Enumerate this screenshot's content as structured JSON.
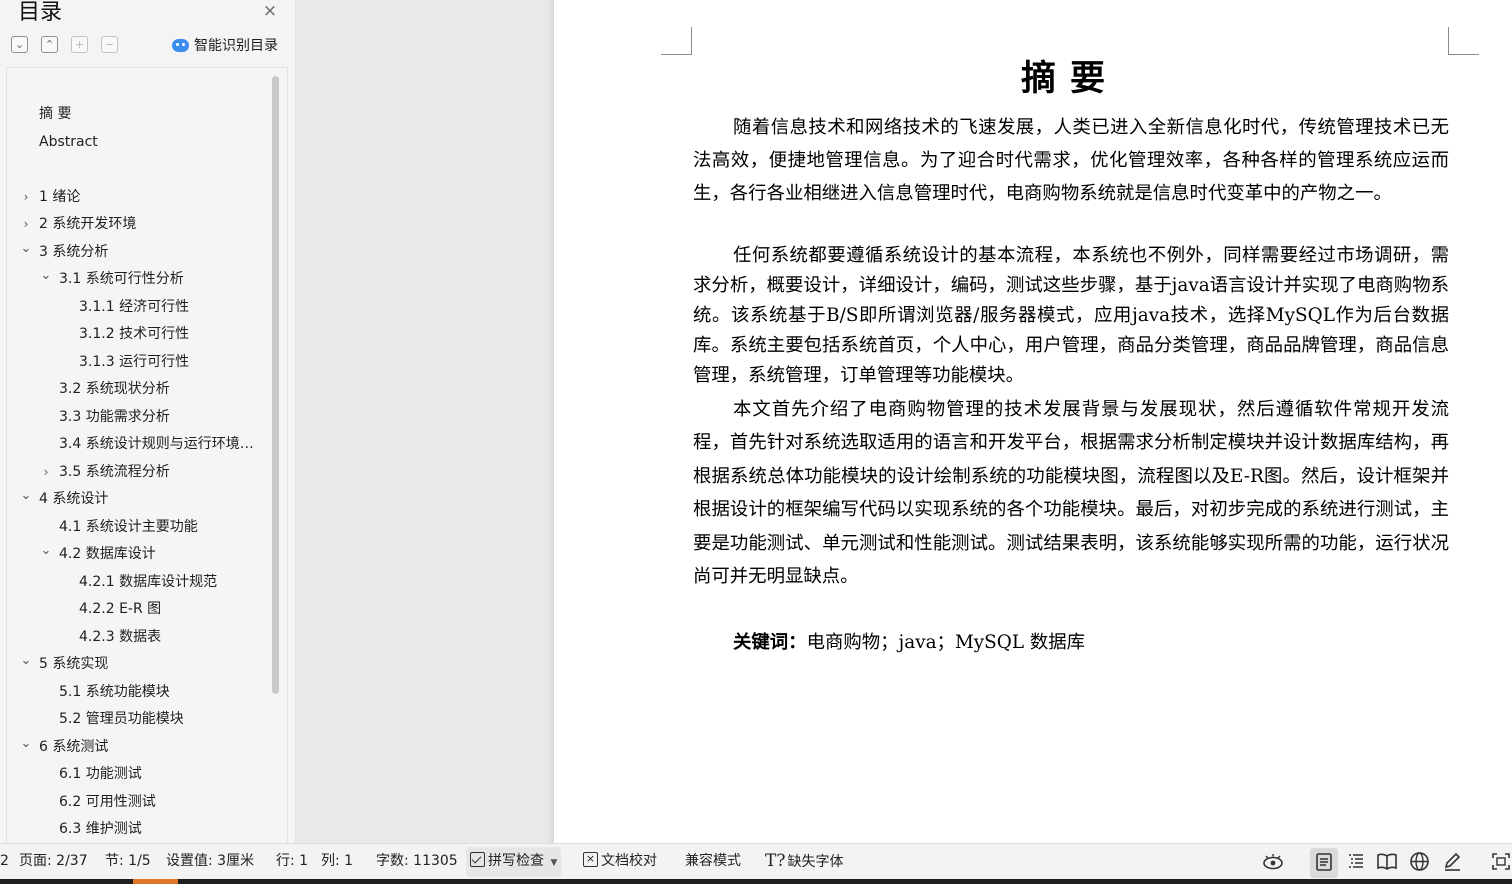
{
  "sidebar": {
    "title": "目录",
    "close_icon": "×",
    "tools": [
      {
        "name": "collapse-all",
        "glyph": "⌄"
      },
      {
        "name": "expand-all",
        "glyph": "⌃"
      },
      {
        "name": "add-level",
        "glyph": "+"
      },
      {
        "name": "remove-level",
        "glyph": "−"
      }
    ],
    "smart_toc_label": "智能识别目录",
    "toc": [
      {
        "label": "摘  要",
        "level": 0,
        "arrow": ""
      },
      {
        "label": "Abstract",
        "level": 0,
        "arrow": ""
      },
      {
        "label": "1  绪论",
        "level": 0,
        "arrow": "›"
      },
      {
        "label": "2  系统开发环境",
        "level": 0,
        "arrow": "›"
      },
      {
        "label": "3  系统分析",
        "level": 0,
        "arrow": "⌄"
      },
      {
        "label": "3.1 系统可行性分析",
        "level": 1,
        "arrow": "⌄"
      },
      {
        "label": "3.1.1 经济可行性",
        "level": 2,
        "arrow": ""
      },
      {
        "label": "3.1.2 技术可行性",
        "level": 2,
        "arrow": ""
      },
      {
        "label": "3.1.3 运行可行性",
        "level": 2,
        "arrow": ""
      },
      {
        "label": "3.2  系统现状分析",
        "level": 1,
        "arrow": ""
      },
      {
        "label": "3.3 功能需求分析",
        "level": 1,
        "arrow": ""
      },
      {
        "label": "3.4 系统设计规则与运行环境说明",
        "level": 1,
        "arrow": ""
      },
      {
        "label": "3.5 系统流程分析",
        "level": 1,
        "arrow": "›"
      },
      {
        "label": "4  系统设计",
        "level": 0,
        "arrow": "⌄"
      },
      {
        "label": "4.1 系统设计主要功能",
        "level": 1,
        "arrow": ""
      },
      {
        "label": "4.2 数据库设计",
        "level": 1,
        "arrow": "⌄"
      },
      {
        "label": "4.2.1 数据库设计规范",
        "level": 2,
        "arrow": ""
      },
      {
        "label": "4.2.2 E-R 图",
        "level": 2,
        "arrow": ""
      },
      {
        "label": "4.2.3 数据表",
        "level": 2,
        "arrow": ""
      },
      {
        "label": "5  系统实现",
        "level": 0,
        "arrow": "⌄"
      },
      {
        "label": "5.1 系统功能模块",
        "level": 1,
        "arrow": ""
      },
      {
        "label": "5.2 管理员功能模块",
        "level": 1,
        "arrow": ""
      },
      {
        "label": "6  系统测试",
        "level": 0,
        "arrow": "⌄"
      },
      {
        "label": "6.1 功能测试",
        "level": 1,
        "arrow": ""
      },
      {
        "label": "6.2 可用性测试",
        "level": 1,
        "arrow": ""
      },
      {
        "label": "6.3 维护测试",
        "level": 1,
        "arrow": ""
      }
    ]
  },
  "document": {
    "heading": "摘要",
    "paragraphs": [
      "随着信息技术和网络技术的飞速发展，人类已进入全新信息化时代，传统管理技术已无法高效，便捷地管理信息。为了迎合时代需求，优化管理效率，各种各样的管理系统应运而生，各行各业相继进入信息管理时代，电商购物系统就是信息时代变革中的产物之一。",
      "任何系统都要遵循系统设计的基本流程，本系统也不例外，同样需要经过市场调研，需求分析，概要设计，详细设计，编码，测试这些步骤，基于java语言设计并实现了电商购物系统。该系统基于B/S即所谓浏览器/服务器模式，应用java技术，选择MySQL作为后台数据库。系统主要包括系统首页，个人中心，用户管理，商品分类管理，商品品牌管理，商品信息管理，系统管理，订单管理等功能模块。",
      "本文首先介绍了电商购物管理的技术发展背景与发展现状，然后遵循软件常规开发流程，首先针对系统选取适用的语言和开发平台，根据需求分析制定模块并设计数据库结构，再根据系统总体功能模块的设计绘制系统的功能模块图，流程图以及E-R图。然后，设计框架并根据设计的框架编写代码以实现系统的各个功能模块。最后，对初步完成的系统进行测试，主要是功能测试、单元测试和性能测试。测试结果表明，该系统能够实现所需的功能，运行状况尚可并无明显缺点。"
    ],
    "keywords_label": "关键词：",
    "keywords_text": "电商购物；java；MySQL 数据库"
  },
  "statusbar": {
    "edge_digit": "2",
    "page": "页面: 2/37",
    "section": "节: 1/5",
    "setting": "设置值: 3厘米",
    "row": "行: 1",
    "col": "列: 1",
    "words": "字数: 11305",
    "spell_check": "拼写检查",
    "doc_proof": "文档校对",
    "compat_mode": "兼容模式",
    "missing_fonts": "缺失字体",
    "right_icons": [
      "eye-icon",
      "page-view-icon",
      "outline-view-icon",
      "reading-view-icon",
      "web-view-icon",
      "pen-icon",
      "fullscreen-icon"
    ]
  }
}
